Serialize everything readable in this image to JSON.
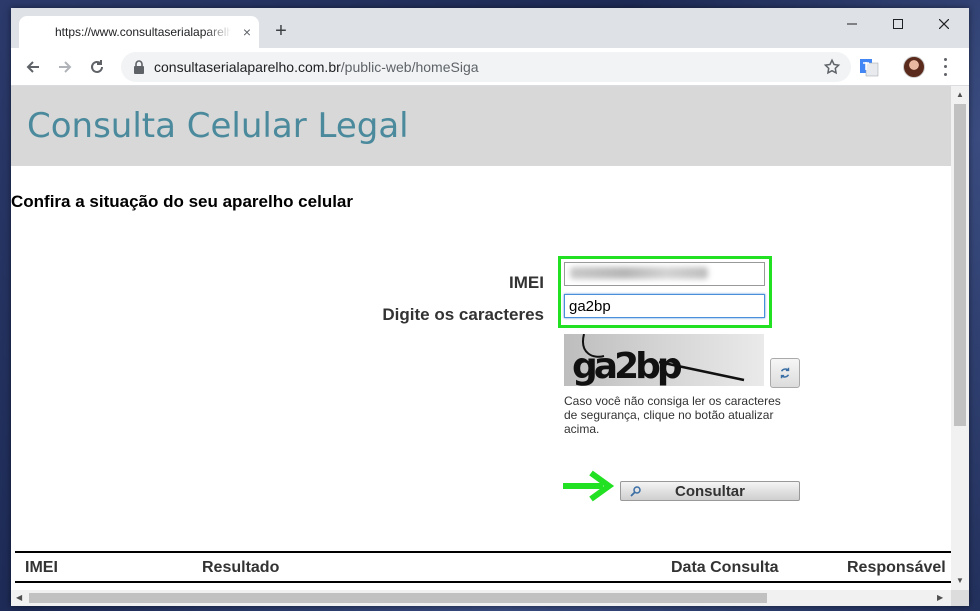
{
  "browser": {
    "tab_title": "https://www.consultaserialaparelho.com.br/public-web/homeSiga",
    "tab_close": "×",
    "new_tab": "+",
    "url_host": "consultaserialaparelho.com.br",
    "url_path": "/public-web/homeSiga"
  },
  "page": {
    "site_title": "Consulta Celular Legal",
    "subtitle": "Confira a situação do seu aparelho celular",
    "form": {
      "imei_label": "IMEI",
      "chars_label": "Digite os caracteres",
      "chars_value": "ga2bp",
      "captcha_text": "ga2bp",
      "help_text": "Caso você não consiga ler os caracteres de segurança, clique no botão atualizar acima.",
      "submit_label": "Consultar"
    },
    "table": {
      "headers": [
        "IMEI",
        "Resultado",
        "Data Consulta",
        "Responsável"
      ]
    }
  },
  "colors": {
    "highlight": "#22e022",
    "title": "#4a8a9c",
    "banner": "#d8d8d8"
  }
}
